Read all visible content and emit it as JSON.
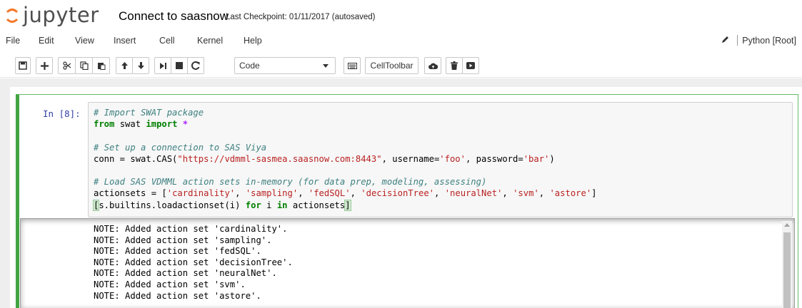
{
  "header": {
    "logo_text": "jupyter",
    "notebook_name": "Connect to saasnow",
    "checkpoint": "Last Checkpoint: 01/11/2017 (autosaved)"
  },
  "menu": [
    "File",
    "Edit",
    "View",
    "Insert",
    "Cell",
    "Kernel",
    "Help"
  ],
  "kernel": {
    "name": "Python [Root]"
  },
  "toolbar": {
    "cell_type": "Code",
    "celltoolbar_label": "CellToolbar",
    "icons": [
      "save-icon",
      "plus-icon",
      "scissors-icon",
      "copy-icon",
      "paste-icon",
      "arrow-up-icon",
      "arrow-down-icon",
      "step-forward-icon",
      "stop-icon",
      "restart-icon",
      "keyboard-icon",
      "cloud-upload-icon",
      "trash-icon",
      "youtube-icon"
    ]
  },
  "cell": {
    "prompt": "In [8]:",
    "code": {
      "l1": "# Import SWAT package",
      "l2_kw1": "from",
      "l2_mod": " swat ",
      "l2_kw2": "import",
      "l2_op": " *",
      "l4": "# Set up a connection to SAS Viya",
      "l5_a": "conn = swat.CAS(",
      "l5_url": "\"https://vdmml-sasmea.saasnow.com:8443\"",
      "l5_b": ", username=",
      "l5_user": "'foo'",
      "l5_c": ", password=",
      "l5_pw": "'bar'",
      "l5_d": ")",
      "l7": "# Load SAS VDMML action sets in-memory (for data prep, modeling, assessing)",
      "l8_a": "actionsets = [",
      "l8_s1": "'cardinality'",
      "l8_s2": "'sampling'",
      "l8_s3": "'fedSQL'",
      "l8_s4": "'decisionTree'",
      "l8_s5": "'neuralNet'",
      "l8_s6": "'svm'",
      "l8_s7": "'astore'",
      "sep": ", ",
      "l8_end": "]",
      "l9_open": "[",
      "l9_a": "s.builtins.loadactionset(i) ",
      "l9_for": "for",
      "l9_b": " i ",
      "l9_in": "in",
      "l9_c": " actionsets",
      "l9_close": "]"
    },
    "output": [
      "NOTE: Added action set 'cardinality'.",
      "NOTE: Added action set 'sampling'.",
      "NOTE: Added action set 'fedSQL'.",
      "NOTE: Added action set 'decisionTree'.",
      "NOTE: Added action set 'neuralNet'.",
      "NOTE: Added action set 'svm'.",
      "NOTE: Added action set 'astore'."
    ]
  },
  "colors": {
    "selected_cell_border": "#42a542",
    "prompt": "#303f9f",
    "comment": "#408080",
    "keyword": "#008000",
    "string": "#ba2121"
  }
}
